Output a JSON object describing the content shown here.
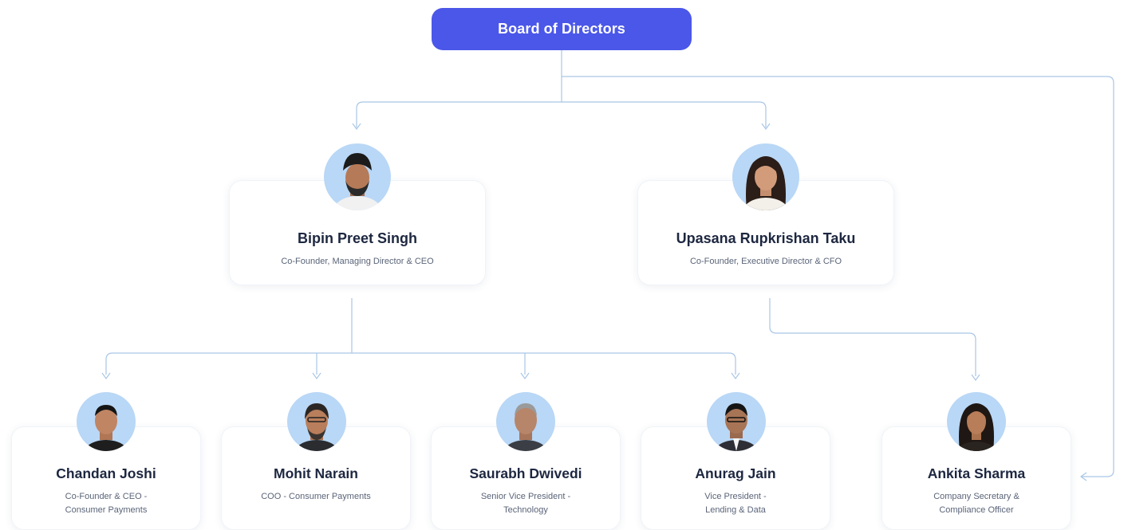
{
  "board": {
    "label": "Board of Directors"
  },
  "directors": [
    {
      "name": "Bipin Preet Singh",
      "role": "Co-Founder, Managing Director & CEO"
    },
    {
      "name": "Upasana Rupkrishan Taku",
      "role": "Co-Founder, Executive Director & CFO"
    }
  ],
  "executives": [
    {
      "name": "Chandan Joshi",
      "role_line1": "Co-Founder & CEO -",
      "role_line2": "Consumer Payments"
    },
    {
      "name": "Mohit Narain",
      "role_line1": "COO - Consumer Payments",
      "role_line2": ""
    },
    {
      "name": "Saurabh Dwivedi",
      "role_line1": "Senior Vice President -",
      "role_line2": "Technology"
    },
    {
      "name": "Anurag Jain",
      "role_line1": "Vice President -",
      "role_line2": "Lending & Data"
    },
    {
      "name": "Ankita Sharma",
      "role_line1": "Company Secretary &",
      "role_line2": "Compliance Officer"
    }
  ],
  "colors": {
    "board_bg": "#4b57e8",
    "connector": "#a9c6e6",
    "avatar_bg": "#b9d7f6"
  }
}
